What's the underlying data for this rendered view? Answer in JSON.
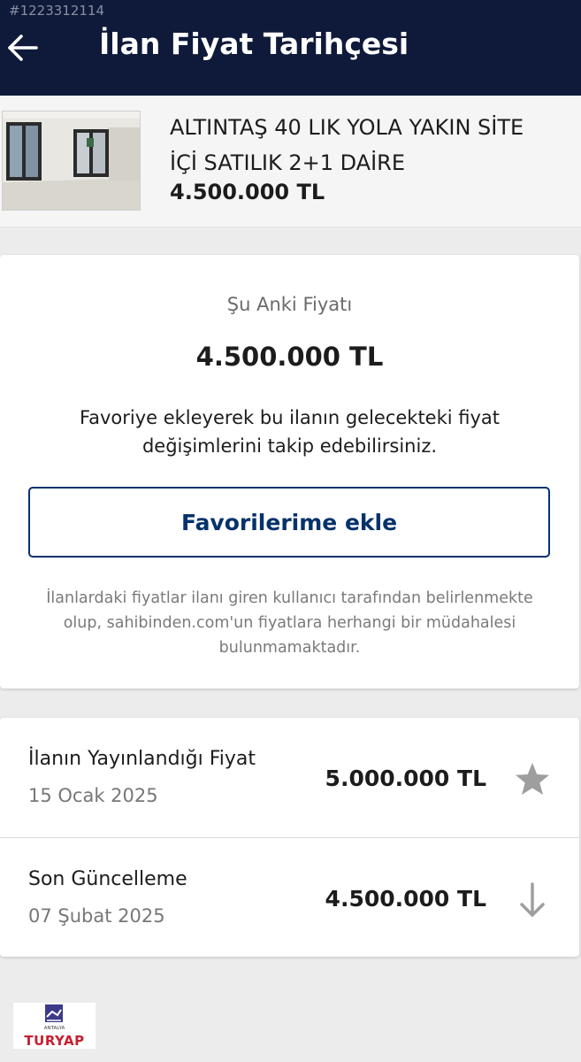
{
  "watermark_id": "#1223312114",
  "header": {
    "title": "İlan Fiyat Tarihçesi",
    "back_icon": "arrow-left-icon"
  },
  "listing": {
    "title_line1": "ALTINTAŞ 40 LIK YOLA YAKIN SİTE",
    "title_line2": "İÇİ SATILIK 2+1 DAİRE",
    "price": "4.500.000 TL"
  },
  "current_price": {
    "label": "Şu Anki Fiyatı",
    "value": "4.500.000 TL",
    "info_line1": "Favoriye ekleyerek bu ilanın gelecekteki fiyat",
    "info_line2": "değişimlerini takip edebilirsiniz.",
    "favorite_button": "Favorilerime ekle",
    "disclaimer_line1": "İlanlardaki fiyatlar ilanı giren kullanıcı tarafından belirlenmekte",
    "disclaimer_line2": "olup, sahibinden.com'un fiyatlara herhangi bir müdahalesi",
    "disclaimer_line3": "bulunmamaktadır."
  },
  "history": [
    {
      "label": "İlanın Yayınlandığı Fiyat",
      "date": "15 Ocak 2025",
      "price": "5.000.000 TL",
      "icon": "star-icon"
    },
    {
      "label": "Son Güncelleme",
      "date": "07 Şubat 2025",
      "price": "4.500.000 TL",
      "icon": "arrow-down-icon"
    }
  ],
  "logo": {
    "small": "ANTALYA",
    "text": "TURYAP"
  },
  "colors": {
    "header_bg": "#0f1a3a",
    "accent": "#06326b",
    "page_bg": "#ececec"
  }
}
